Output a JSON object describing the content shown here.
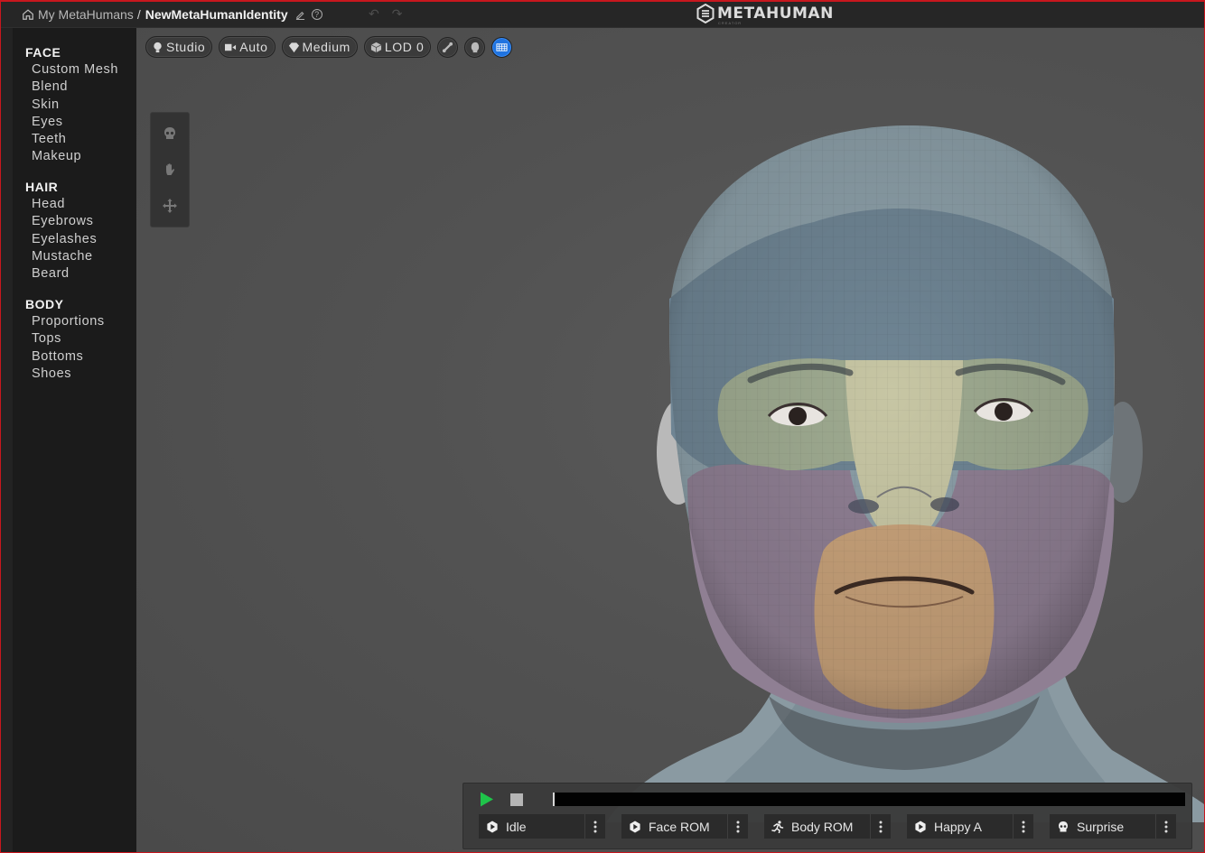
{
  "titlebar": {
    "home_icon": "home-icon",
    "breadcrumb_root": "My MetaHumans",
    "breadcrumb_separator": "/",
    "breadcrumb_current": "NewMetaHumanIdentity",
    "edit_icon": "pencil-icon",
    "help_icon": "question-circle-icon",
    "help_glyph": "?",
    "undo_icon": "undo-icon",
    "redo_icon": "redo-icon",
    "undo_glyph": "↶",
    "redo_glyph": "↷",
    "logo_text": "METAHUMAN",
    "logo_subtext": "CREATOR"
  },
  "sidebar": {
    "sections": [
      {
        "title": "FACE",
        "items": [
          "Custom Mesh",
          "Blend",
          "Skin",
          "Eyes",
          "Teeth",
          "Makeup"
        ]
      },
      {
        "title": "HAIR",
        "items": [
          "Head",
          "Eyebrows",
          "Eyelashes",
          "Mustache",
          "Beard"
        ]
      },
      {
        "title": "BODY",
        "items": [
          "Proportions",
          "Tops",
          "Bottoms",
          "Shoes"
        ]
      }
    ]
  },
  "viewport_toolbar": {
    "lighting": {
      "label": "Studio",
      "icon": "lightbulb-icon"
    },
    "camera": {
      "label": "Auto",
      "icon": "camera-icon"
    },
    "quality": {
      "label": "Medium",
      "icon": "diamond-icon"
    },
    "lod": {
      "label": "LOD 0",
      "icon": "cube-icon"
    },
    "round_buttons": [
      {
        "name": "bone-icon",
        "active": false
      },
      {
        "name": "head-icon",
        "active": false
      },
      {
        "name": "wireframe-icon",
        "active": true
      }
    ]
  },
  "side_tools": [
    {
      "name": "skull-icon"
    },
    {
      "name": "hand-icon"
    },
    {
      "name": "move-icon"
    }
  ],
  "animation_panel": {
    "play_icon": "play-icon",
    "stop_icon": "stop-icon",
    "timeline_progress": 0,
    "colors": {
      "play": "#1fc44a",
      "active_blue": "#1f73e0",
      "frame_red": "#c8171e"
    },
    "animations": [
      {
        "label": "Idle",
        "icon": "play-circle-icon"
      },
      {
        "label": "Face ROM",
        "icon": "play-circle-icon"
      },
      {
        "label": "Body ROM",
        "icon": "running-person-icon"
      },
      {
        "label": "Happy A",
        "icon": "play-circle-icon"
      },
      {
        "label": "Surprise",
        "icon": "skull-icon"
      }
    ]
  }
}
